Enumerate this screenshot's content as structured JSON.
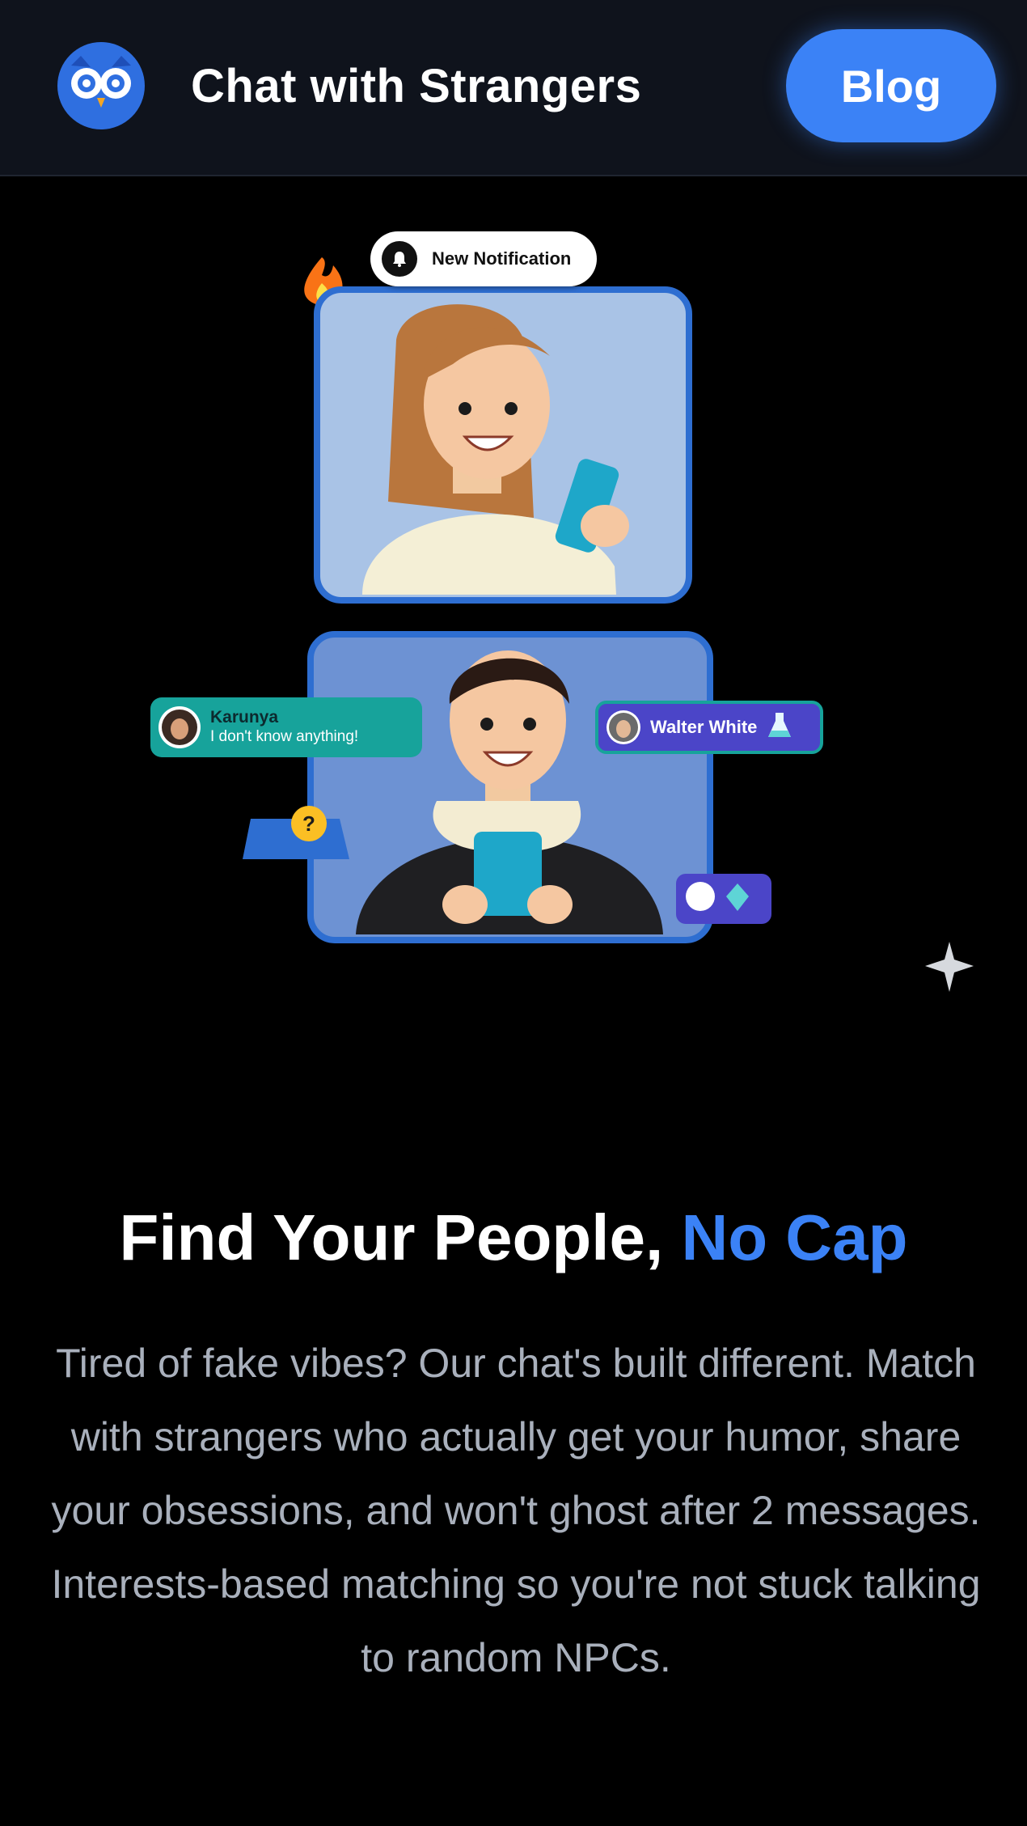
{
  "header": {
    "title": "Chat with Strangers",
    "blog_label": "Blog",
    "logo_icon": "owl-logo-icon"
  },
  "hero": {
    "notification_label": "New Notification",
    "karunya": {
      "name": "Karunya",
      "message": "I don't know anything!"
    },
    "walter": {
      "name": "Walter White"
    }
  },
  "main": {
    "headline_start": "Find Your People, ",
    "headline_accent": "No Cap",
    "body": "Tired of fake vibes? Our chat's built different. Match with strangers who actually get your humor, share your obsessions, and won't ghost after 2 messages. Interests-based matching so you're not stuck talking to random NPCs."
  },
  "colors": {
    "header_bg": "#0f131c",
    "page_bg": "#000000",
    "accent": "#3b82f6",
    "body_text": "#a9b0bc",
    "card_border": "#2e6ed1",
    "teal": "#17a39b",
    "purple": "#4b45c8"
  }
}
